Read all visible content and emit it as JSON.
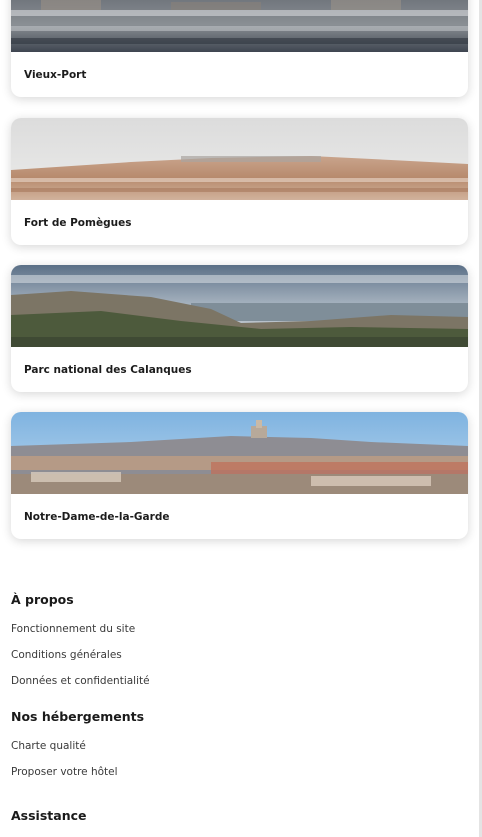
{
  "cards": [
    {
      "title": "Vieux-Port"
    },
    {
      "title": "Fort de Pomègues"
    },
    {
      "title": "Parc national des Calanques"
    },
    {
      "title": "Notre-Dame-de-la-Garde"
    }
  ],
  "footer": {
    "about": {
      "heading": "À propos",
      "links": [
        "Fonctionnement du site",
        "Conditions générales",
        "Données et confidentialité"
      ]
    },
    "accommodations": {
      "heading": "Nos hébergements",
      "links": [
        "Charte qualité",
        "Proposer votre hôtel"
      ]
    },
    "support": {
      "heading": "Assistance"
    }
  }
}
